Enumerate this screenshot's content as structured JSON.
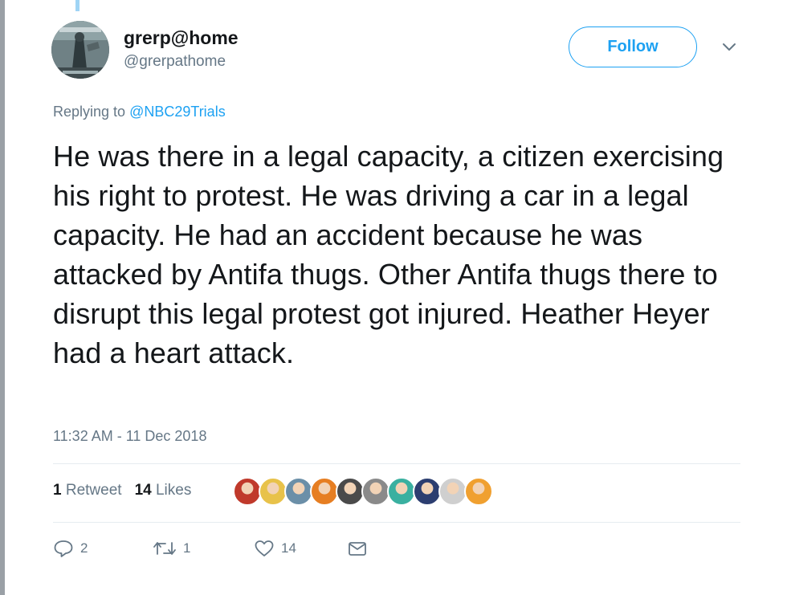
{
  "tweet": {
    "display_name": "grerp@home",
    "handle": "@grerpathome",
    "follow_label": "Follow",
    "replying_prefix": "Replying to ",
    "replying_to": "@NBC29Trials",
    "text": "He was there in a legal capacity, a citizen exercising his right to protest. He was driving a car in a legal capacity. He had an accident because he was attacked by Antifa thugs. Other Antifa thugs there to disrupt this legal protest got injured. Heather Heyer had a heart attack.",
    "timestamp": "11:32 AM - 11 Dec 2018"
  },
  "stats": {
    "retweets_count": "1",
    "retweets_label": "Retweet",
    "likes_count": "14",
    "likes_label": "Likes"
  },
  "likers": [
    {
      "icon": "liker-avatar-red-robot",
      "color": "#c0392b"
    },
    {
      "icon": "liker-avatar-cartoon",
      "color": "#e8c24a"
    },
    {
      "icon": "liker-avatar-man-hat",
      "color": "#6b8fa8"
    },
    {
      "icon": "liker-avatar-colorful",
      "color": "#e67e22"
    },
    {
      "icon": "liker-avatar-dark-portrait",
      "color": "#4a4a4a"
    },
    {
      "icon": "liker-avatar-portrait-gray",
      "color": "#8a8a8a"
    },
    {
      "icon": "liker-avatar-pop-art",
      "color": "#3ab0a0"
    },
    {
      "icon": "liker-avatar-seal",
      "color": "#2c3e70"
    },
    {
      "icon": "liker-avatar-sketch",
      "color": "#cfcfcf"
    },
    {
      "icon": "liker-avatar-hand",
      "color": "#f0a030"
    }
  ],
  "actions": {
    "reply_count": "2",
    "retweet_count": "1",
    "like_count": "14"
  },
  "colors": {
    "accent": "#1da1f2",
    "secondary_text": "#657786",
    "primary_text": "#14171a"
  }
}
